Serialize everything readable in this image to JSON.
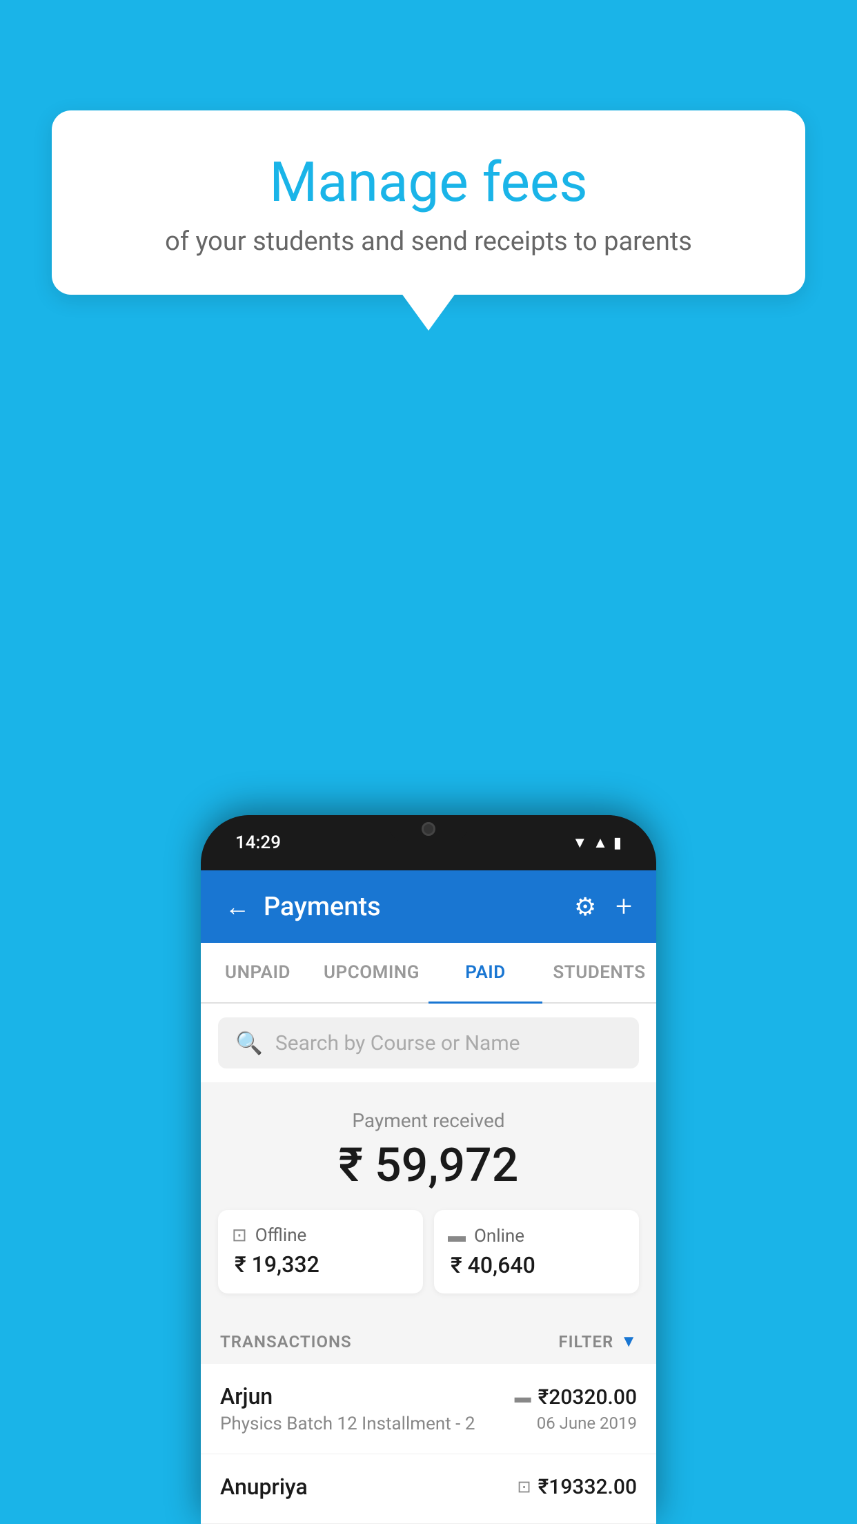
{
  "background_color": "#1ab4e8",
  "tooltip": {
    "title": "Manage fees",
    "subtitle": "of your students and send receipts to parents"
  },
  "phone": {
    "time": "14:29",
    "header": {
      "title": "Payments",
      "back_label": "←",
      "settings_label": "⚙",
      "add_label": "+"
    },
    "tabs": [
      {
        "label": "UNPAID",
        "active": false
      },
      {
        "label": "UPCOMING",
        "active": false
      },
      {
        "label": "PAID",
        "active": true
      },
      {
        "label": "STUDENTS",
        "active": false
      }
    ],
    "search": {
      "placeholder": "Search by Course or Name"
    },
    "payment_summary": {
      "label": "Payment received",
      "total_amount": "₹ 59,972",
      "offline_label": "Offline",
      "offline_amount": "₹ 19,332",
      "online_label": "Online",
      "online_amount": "₹ 40,640"
    },
    "transactions": {
      "section_label": "TRANSACTIONS",
      "filter_label": "FILTER",
      "items": [
        {
          "name": "Arjun",
          "course": "Physics Batch 12 Installment - 2",
          "amount": "₹20320.00",
          "date": "06 June 2019",
          "payment_type": "card"
        },
        {
          "name": "Anupriya",
          "course": "",
          "amount": "₹19332.00",
          "date": "",
          "payment_type": "cash"
        }
      ]
    }
  }
}
